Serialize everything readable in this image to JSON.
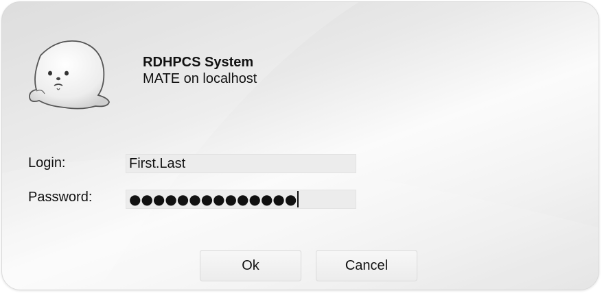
{
  "header": {
    "title": "RDHPCS System",
    "subtitle": "MATE on localhost",
    "logo_icon": "seal-mascot-icon"
  },
  "form": {
    "login_label": "Login:",
    "login_value": "First.Last",
    "password_label": "Password:",
    "password_mask": "●●●●●●●●●●●●●●"
  },
  "buttons": {
    "ok_label": "Ok",
    "cancel_label": "Cancel"
  }
}
